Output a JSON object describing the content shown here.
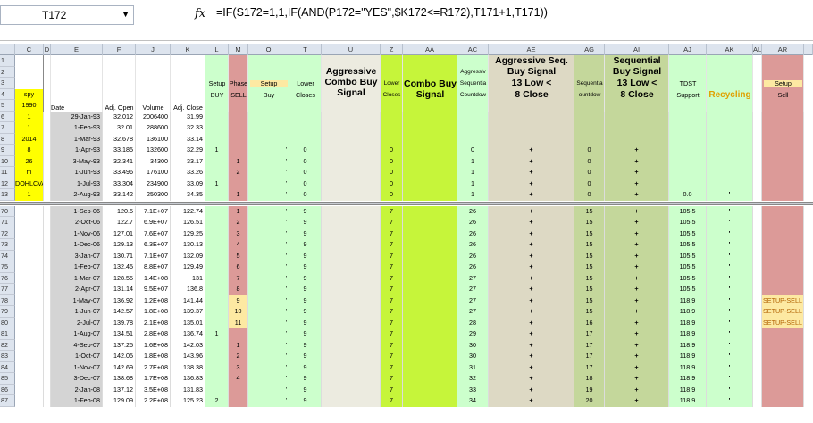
{
  "formula_bar": {
    "name_box": "T172",
    "fx_label": "fx",
    "formula": "=IF(S172=1,1,IF(AND(P172=\"YES\",$K172<=R172),T171+1,T171))"
  },
  "columns": [
    "C",
    "D",
    "E",
    "F",
    "J",
    "K",
    "L",
    "M",
    "O",
    "T",
    "U",
    "Z",
    "AA",
    "AC",
    "AE",
    "AG",
    "AI",
    "AJ",
    "AK",
    "AL",
    "AR"
  ],
  "headers": {
    "L_setup": "Setup",
    "L_buy": "BUY",
    "M_phase": "Phase",
    "M_sell": "SELL",
    "O_setup": "Setup",
    "O_buy": "Buy",
    "T_lower": "Lower",
    "T_closes": "Closes",
    "U_title": "Aggressive Combo Buy Signal",
    "Z_lower": "Lower",
    "Z_closes": "Closes",
    "AA_title": "Combo Buy Signal",
    "AC_aggr": "Aggressiv",
    "AC_seq": "Sequentia",
    "AC_count": "Countdow",
    "AE_title": "Aggressive Seq. Buy Signal",
    "AE_line2": "13 Low <",
    "AE_line3": "8 Close",
    "AG_seq": "Sequentia",
    "AG_count": "ountdow",
    "AI_title": "Sequential Buy Signal",
    "AI_line2": "13 Low <",
    "AI_line3": "8 Close",
    "AJ_tdst": "TDST",
    "AJ_support": "Support",
    "AK_title": "Recycling",
    "AR_setup": "Setup",
    "AR_sell": "Sell",
    "date": "Date",
    "adj_open": "Adj. Open",
    "volume": "Volume",
    "adj_close": "Adj. Close"
  },
  "c_column": {
    "4": "spy",
    "5": "1990",
    "6": "1",
    "7": "1",
    "8": "2014",
    "9": "8",
    "10": "26",
    "11": "m",
    "12": "DOHLCVA",
    "13": "1"
  },
  "top_rows": [
    {
      "rn": "6",
      "date": "29-Jan-93",
      "open": "32.012",
      "vol": "2006400",
      "close": "31.99",
      "L": "",
      "M": "",
      "O": "",
      "T": "",
      "Z": "",
      "AC": "",
      "AE": "",
      "AG": "",
      "AI": "",
      "AJ": "",
      "AK": ""
    },
    {
      "rn": "7",
      "date": "1-Feb-93",
      "open": "32.01",
      "vol": "288600",
      "close": "32.33",
      "L": "",
      "M": "",
      "O": "",
      "T": "",
      "Z": "",
      "AC": "",
      "AE": "",
      "AG": "",
      "AI": "",
      "AJ": "",
      "AK": ""
    },
    {
      "rn": "8",
      "date": "1-Mar-93",
      "open": "32.678",
      "vol": "136100",
      "close": "33.14",
      "L": "",
      "M": "",
      "O": "",
      "T": "",
      "Z": "",
      "AC": "",
      "AE": "",
      "AG": "",
      "AI": "",
      "AJ": "",
      "AK": ""
    },
    {
      "rn": "9",
      "date": "1-Apr-93",
      "open": "33.185",
      "vol": "132600",
      "close": "32.29",
      "L": "1",
      "M": "",
      "O": "'",
      "T": "0",
      "Z": "0",
      "AC": "0",
      "AE": "+",
      "AG": "0",
      "AI": "+",
      "AJ": "",
      "AK": ""
    },
    {
      "rn": "10",
      "date": "3-May-93",
      "open": "32.341",
      "vol": "34300",
      "close": "33.17",
      "L": "",
      "M": "1",
      "O": "'",
      "T": "0",
      "Z": "0",
      "AC": "1",
      "AE": "+",
      "AG": "0",
      "AI": "+",
      "AJ": "",
      "AK": ""
    },
    {
      "rn": "11",
      "date": "1-Jun-93",
      "open": "33.496",
      "vol": "176100",
      "close": "33.26",
      "L": "",
      "M": "2",
      "O": "'",
      "T": "0",
      "Z": "0",
      "AC": "1",
      "AE": "+",
      "AG": "0",
      "AI": "+",
      "AJ": "",
      "AK": ""
    },
    {
      "rn": "12",
      "date": "1-Jul-93",
      "open": "33.304",
      "vol": "234900",
      "close": "33.09",
      "L": "1",
      "M": "",
      "O": "'",
      "T": "0",
      "Z": "0",
      "AC": "1",
      "AE": "+",
      "AG": "0",
      "AI": "+",
      "AJ": "",
      "AK": ""
    },
    {
      "rn": "13",
      "date": "2-Aug-93",
      "open": "33.142",
      "vol": "250300",
      "close": "34.35",
      "L": "",
      "M": "1",
      "O": "'",
      "T": "0",
      "Z": "0",
      "AC": "1",
      "AE": "+",
      "AG": "0",
      "AI": "+",
      "AJ": "0.0",
      "AK": "'"
    }
  ],
  "bottom_rows": [
    {
      "rn": "70",
      "date": "1-Sep-06",
      "open": "120.5",
      "vol": "7.1E+07",
      "close": "122.74",
      "L": "",
      "M": "1",
      "O": "'",
      "T": "9",
      "Z": "7",
      "AC": "26",
      "AE": "+",
      "AG": "15",
      "AI": "+",
      "AJ": "105.5",
      "AK": "'",
      "AR": ""
    },
    {
      "rn": "71",
      "date": "2-Oct-06",
      "open": "122.7",
      "vol": "6.9E+07",
      "close": "126.51",
      "L": "",
      "M": "2",
      "O": "'",
      "T": "9",
      "Z": "7",
      "AC": "26",
      "AE": "+",
      "AG": "15",
      "AI": "+",
      "AJ": "105.5",
      "AK": "'",
      "AR": ""
    },
    {
      "rn": "72",
      "date": "1-Nov-06",
      "open": "127.01",
      "vol": "7.6E+07",
      "close": "129.25",
      "L": "",
      "M": "3",
      "O": "'",
      "T": "9",
      "Z": "7",
      "AC": "26",
      "AE": "+",
      "AG": "15",
      "AI": "+",
      "AJ": "105.5",
      "AK": "'",
      "AR": ""
    },
    {
      "rn": "73",
      "date": "1-Dec-06",
      "open": "129.13",
      "vol": "6.3E+07",
      "close": "130.13",
      "L": "",
      "M": "4",
      "O": "'",
      "T": "9",
      "Z": "7",
      "AC": "26",
      "AE": "+",
      "AG": "15",
      "AI": "+",
      "AJ": "105.5",
      "AK": "'",
      "AR": ""
    },
    {
      "rn": "74",
      "date": "3-Jan-07",
      "open": "130.71",
      "vol": "7.1E+07",
      "close": "132.09",
      "L": "",
      "M": "5",
      "O": "'",
      "T": "9",
      "Z": "7",
      "AC": "26",
      "AE": "+",
      "AG": "15",
      "AI": "+",
      "AJ": "105.5",
      "AK": "'",
      "AR": ""
    },
    {
      "rn": "75",
      "date": "1-Feb-07",
      "open": "132.45",
      "vol": "8.8E+07",
      "close": "129.49",
      "L": "",
      "M": "6",
      "O": "'",
      "T": "9",
      "Z": "7",
      "AC": "26",
      "AE": "+",
      "AG": "15",
      "AI": "+",
      "AJ": "105.5",
      "AK": "'",
      "AR": ""
    },
    {
      "rn": "76",
      "date": "1-Mar-07",
      "open": "128.55",
      "vol": "1.4E+08",
      "close": "131",
      "L": "",
      "M": "7",
      "O": "'",
      "T": "9",
      "Z": "7",
      "AC": "27",
      "AE": "+",
      "AG": "15",
      "AI": "+",
      "AJ": "105.5",
      "AK": "'",
      "AR": ""
    },
    {
      "rn": "77",
      "date": "2-Apr-07",
      "open": "131.14",
      "vol": "9.5E+07",
      "close": "136.8",
      "L": "",
      "M": "8",
      "O": "'",
      "T": "9",
      "Z": "7",
      "AC": "27",
      "AE": "+",
      "AG": "15",
      "AI": "+",
      "AJ": "105.5",
      "AK": "'",
      "AR": ""
    },
    {
      "rn": "78",
      "date": "1-May-07",
      "open": "136.92",
      "vol": "1.2E+08",
      "close": "141.44",
      "L": "",
      "M": "9",
      "O": "'",
      "T": "9",
      "Z": "7",
      "AC": "27",
      "AE": "+",
      "AG": "15",
      "AI": "+",
      "AJ": "118.9",
      "AK": "'",
      "AR": "SETUP-SELL"
    },
    {
      "rn": "79",
      "date": "1-Jun-07",
      "open": "142.57",
      "vol": "1.8E+08",
      "close": "139.37",
      "L": "",
      "M": "10",
      "O": "'",
      "T": "9",
      "Z": "7",
      "AC": "27",
      "AE": "+",
      "AG": "15",
      "AI": "+",
      "AJ": "118.9",
      "AK": "'",
      "AR": "SETUP-SELL"
    },
    {
      "rn": "80",
      "date": "2-Jul-07",
      "open": "139.78",
      "vol": "2.1E+08",
      "close": "135.01",
      "L": "",
      "M": "11",
      "O": "'",
      "T": "9",
      "Z": "7",
      "AC": "28",
      "AE": "+",
      "AG": "16",
      "AI": "+",
      "AJ": "118.9",
      "AK": "'",
      "AR": "SETUP-SELL"
    },
    {
      "rn": "81",
      "date": "1-Aug-07",
      "open": "134.51",
      "vol": "2.8E+08",
      "close": "136.74",
      "L": "1",
      "M": "",
      "O": "'",
      "T": "9",
      "Z": "7",
      "AC": "29",
      "AE": "+",
      "AG": "17",
      "AI": "+",
      "AJ": "118.9",
      "AK": "'",
      "AR": ""
    },
    {
      "rn": "82",
      "date": "4-Sep-07",
      "open": "137.25",
      "vol": "1.6E+08",
      "close": "142.03",
      "L": "",
      "M": "1",
      "O": "'",
      "T": "9",
      "Z": "7",
      "AC": "30",
      "AE": "+",
      "AG": "17",
      "AI": "+",
      "AJ": "118.9",
      "AK": "'",
      "AR": ""
    },
    {
      "rn": "83",
      "date": "1-Oct-07",
      "open": "142.05",
      "vol": "1.8E+08",
      "close": "143.96",
      "L": "",
      "M": "2",
      "O": "'",
      "T": "9",
      "Z": "7",
      "AC": "30",
      "AE": "+",
      "AG": "17",
      "AI": "+",
      "AJ": "118.9",
      "AK": "'",
      "AR": ""
    },
    {
      "rn": "84",
      "date": "1-Nov-07",
      "open": "142.69",
      "vol": "2.7E+08",
      "close": "138.38",
      "L": "",
      "M": "3",
      "O": "'",
      "T": "9",
      "Z": "7",
      "AC": "31",
      "AE": "+",
      "AG": "17",
      "AI": "+",
      "AJ": "118.9",
      "AK": "'",
      "AR": ""
    },
    {
      "rn": "85",
      "date": "3-Dec-07",
      "open": "138.68",
      "vol": "1.7E+08",
      "close": "136.83",
      "L": "",
      "M": "4",
      "O": "'",
      "T": "9",
      "Z": "7",
      "AC": "32",
      "AE": "+",
      "AG": "18",
      "AI": "+",
      "AJ": "118.9",
      "AK": "'",
      "AR": ""
    },
    {
      "rn": "86",
      "date": "2-Jan-08",
      "open": "137.12",
      "vol": "3.5E+08",
      "close": "131.83",
      "L": "",
      "M": "",
      "O": "'",
      "T": "9",
      "Z": "7",
      "AC": "33",
      "AE": "+",
      "AG": "19",
      "AI": "+",
      "AJ": "118.9",
      "AK": "'",
      "AR": ""
    },
    {
      "rn": "87",
      "date": "1-Feb-08",
      "open": "129.09",
      "vol": "2.2E+08",
      "close": "125.23",
      "L": "2",
      "M": "",
      "O": "'",
      "T": "9",
      "Z": "7",
      "AC": "34",
      "AE": "+",
      "AG": "20",
      "AI": "+",
      "AJ": "118.9",
      "AK": "'",
      "AR": ""
    }
  ],
  "colors": {
    "grid_bg": "#ffffff",
    "header_bg": "#dde4ee",
    "yellow": "#ffff00",
    "gray_dates": "#d4d4d4",
    "green_light": "#ccffcc",
    "pink_m": "#dc9a98",
    "beige": "#ecebe0",
    "lime": "#c6f53a",
    "tan": "#ddd9c4",
    "olive_green": "#c4d79b",
    "orange_light": "#fde9a2"
  }
}
